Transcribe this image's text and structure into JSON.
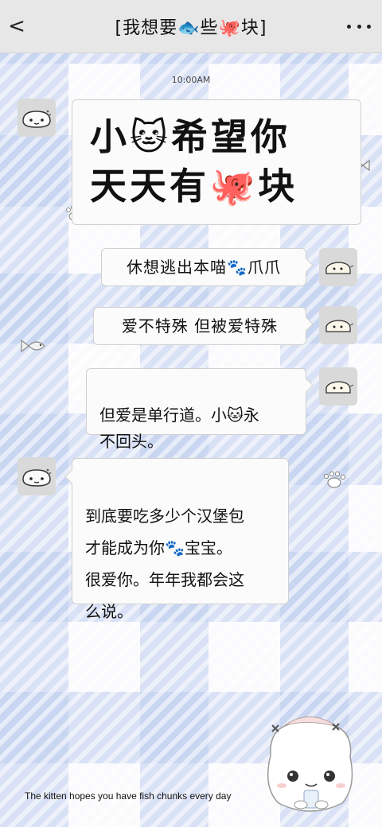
{
  "header": {
    "back_label": "<",
    "title": "[我想要🐟些🐙块]"
  },
  "chat": {
    "timestamp": "10:00AM",
    "messages": [
      {
        "side": "left",
        "text": "小🐱希望你\n天天有🐙块"
      },
      {
        "side": "right",
        "text": "休想逃出本喵🐾爪爪"
      },
      {
        "side": "right",
        "text": "爱不特殊  但被爱特殊"
      },
      {
        "side": "right",
        "text": "但爱是单行道。小🐱永\n不回头。"
      },
      {
        "side": "left",
        "text": "到底要吃多少个汉堡包\n才能成为你🐾宝宝。\n很爱你。年年我都会这\n么说。"
      }
    ]
  },
  "footer": {
    "caption": "The kitten hopes you have fish chunks every day"
  },
  "colors": {
    "header_bg": "#e7e7e7",
    "bubble_bg": "#fbfbfb",
    "plaid_blue": "#bcccee"
  }
}
